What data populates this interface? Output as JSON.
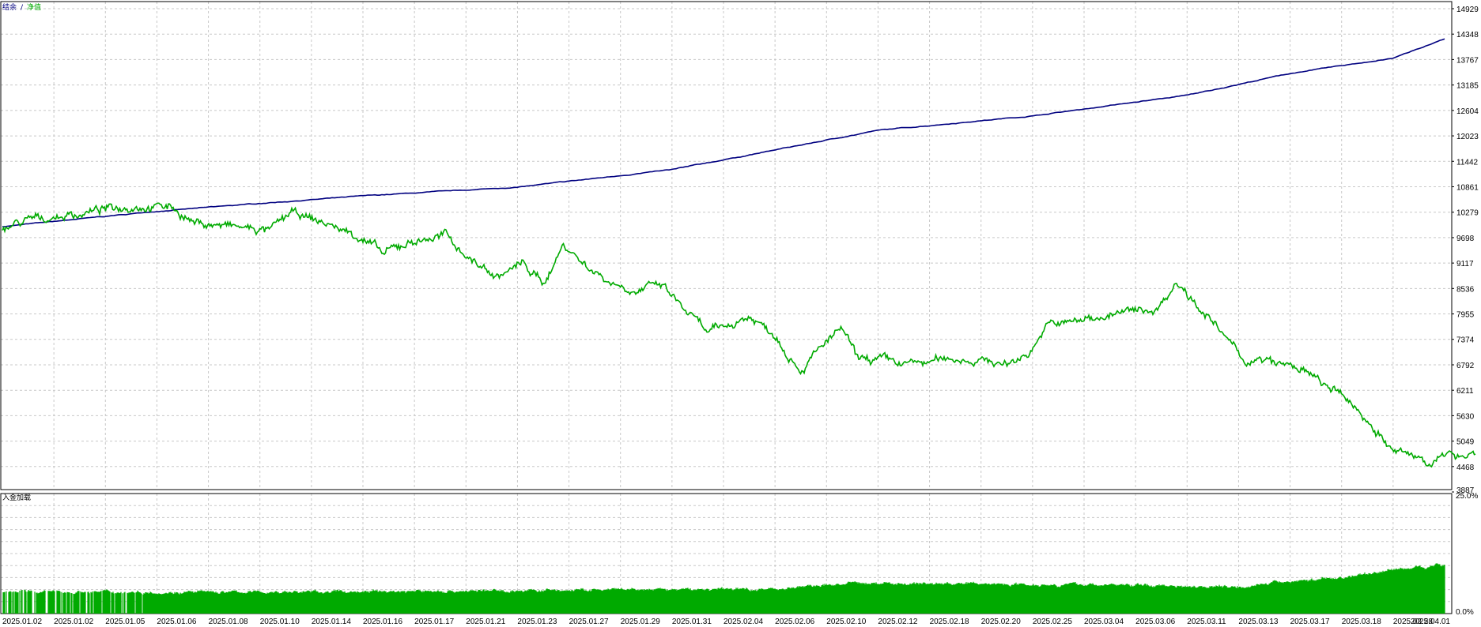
{
  "legend": {
    "balance_label": "结余",
    "separator": "/",
    "equity_label": "净值",
    "balance_color": "#000080",
    "equity_color": "#00aa00"
  },
  "subwindow": {
    "label": "入金加载",
    "color": "#00aa00"
  },
  "chart_data": [
    {
      "type": "line",
      "y_ticks": [
        "14929",
        "14348",
        "13767",
        "13185",
        "12604",
        "12023",
        "11442",
        "10861",
        "10279",
        "9698",
        "9117",
        "8536",
        "7955",
        "7374",
        "6792",
        "6211",
        "5630",
        "5049",
        "4468",
        "3887"
      ],
      "ylim": [
        3887,
        14929
      ],
      "x_tick_labels": [
        "2025.01.02",
        "2025.01.02",
        "2025.01.05",
        "2025.01.06",
        "2025.01.08",
        "2025.01.10",
        "2025.01.14",
        "2025.01.16",
        "2025.01.17",
        "2025.01.21",
        "2025.01.23",
        "2025.01.27",
        "2025.01.29",
        "2025.01.31",
        "2025.02.04",
        "2025.02.06",
        "2025.02.10",
        "2025.02.12",
        "2025.02.18",
        "2025.02.20",
        "2025.02.25",
        "2025.03.04",
        "2025.03.06",
        "2025.03.11",
        "2025.03.13",
        "2025.03.17",
        "2025.03.18",
        "2025.03.28",
        "2025.04.01"
      ],
      "grid": true,
      "series": [
        {
          "name": "结余",
          "color": "#000080",
          "x_index": [
            0,
            3,
            5,
            7,
            10,
            13,
            15,
            17,
            20,
            23,
            25,
            27,
            28
          ],
          "values": [
            9950,
            10300,
            10480,
            10650,
            10850,
            11250,
            11700,
            12150,
            12480,
            12950,
            13450,
            13800,
            14230
          ]
        },
        {
          "name": "净值",
          "color": "#00aa00",
          "x_index": [
            0.0,
            0.6,
            1.5,
            2.6,
            3.3,
            3.7,
            4.4,
            5.2,
            5.6,
            6.2,
            7.0,
            7.4,
            7.9,
            8.6,
            9.1,
            9.6,
            10.1,
            10.5,
            10.9,
            11.3,
            11.8,
            12.3,
            12.8,
            13.2,
            13.7,
            14.1,
            14.5,
            15.0,
            15.5,
            16.0,
            16.3,
            16.6,
            17.0,
            17.5,
            18.0,
            18.5,
            19.0,
            19.5,
            19.9,
            20.3,
            20.7,
            21.3,
            21.9,
            22.4,
            22.8,
            23.2,
            23.6,
            24.1,
            24.6,
            25.2,
            25.7,
            26.2,
            26.6,
            27.0,
            27.4,
            27.8,
            28.2,
            28.6
          ],
          "values": [
            9950,
            10100,
            10250,
            10450,
            10400,
            10050,
            9950,
            9850,
            10250,
            10050,
            9700,
            9300,
            9600,
            9750,
            9200,
            8800,
            9100,
            8650,
            9550,
            9100,
            8700,
            8500,
            8600,
            8100,
            7500,
            7700,
            7900,
            7500,
            6700,
            7300,
            7600,
            6900,
            6900,
            6800,
            6850,
            6950,
            6900,
            6800,
            7050,
            7700,
            7750,
            7900,
            8000,
            8050,
            8700,
            8200,
            7600,
            6900,
            6850,
            6700,
            6300,
            5900,
            5400,
            4800,
            4700,
            4600,
            4750,
            4800
          ]
        }
      ]
    },
    {
      "type": "area",
      "y_ticks": [
        "25.0%",
        "0.0%"
      ],
      "ylim": [
        0,
        25
      ],
      "grid": true,
      "series": [
        {
          "name": "入金加载",
          "color": "#00aa00",
          "x_index": [
            0,
            3.5,
            5,
            10,
            15,
            16.5,
            19,
            22,
            24,
            25,
            26,
            27,
            28
          ],
          "values": [
            4.7,
            4.6,
            4.6,
            4.9,
            5.3,
            6.5,
            6.4,
            6.1,
            5.8,
            6.9,
            7.7,
            9.4,
            10.5
          ]
        }
      ]
    }
  ]
}
